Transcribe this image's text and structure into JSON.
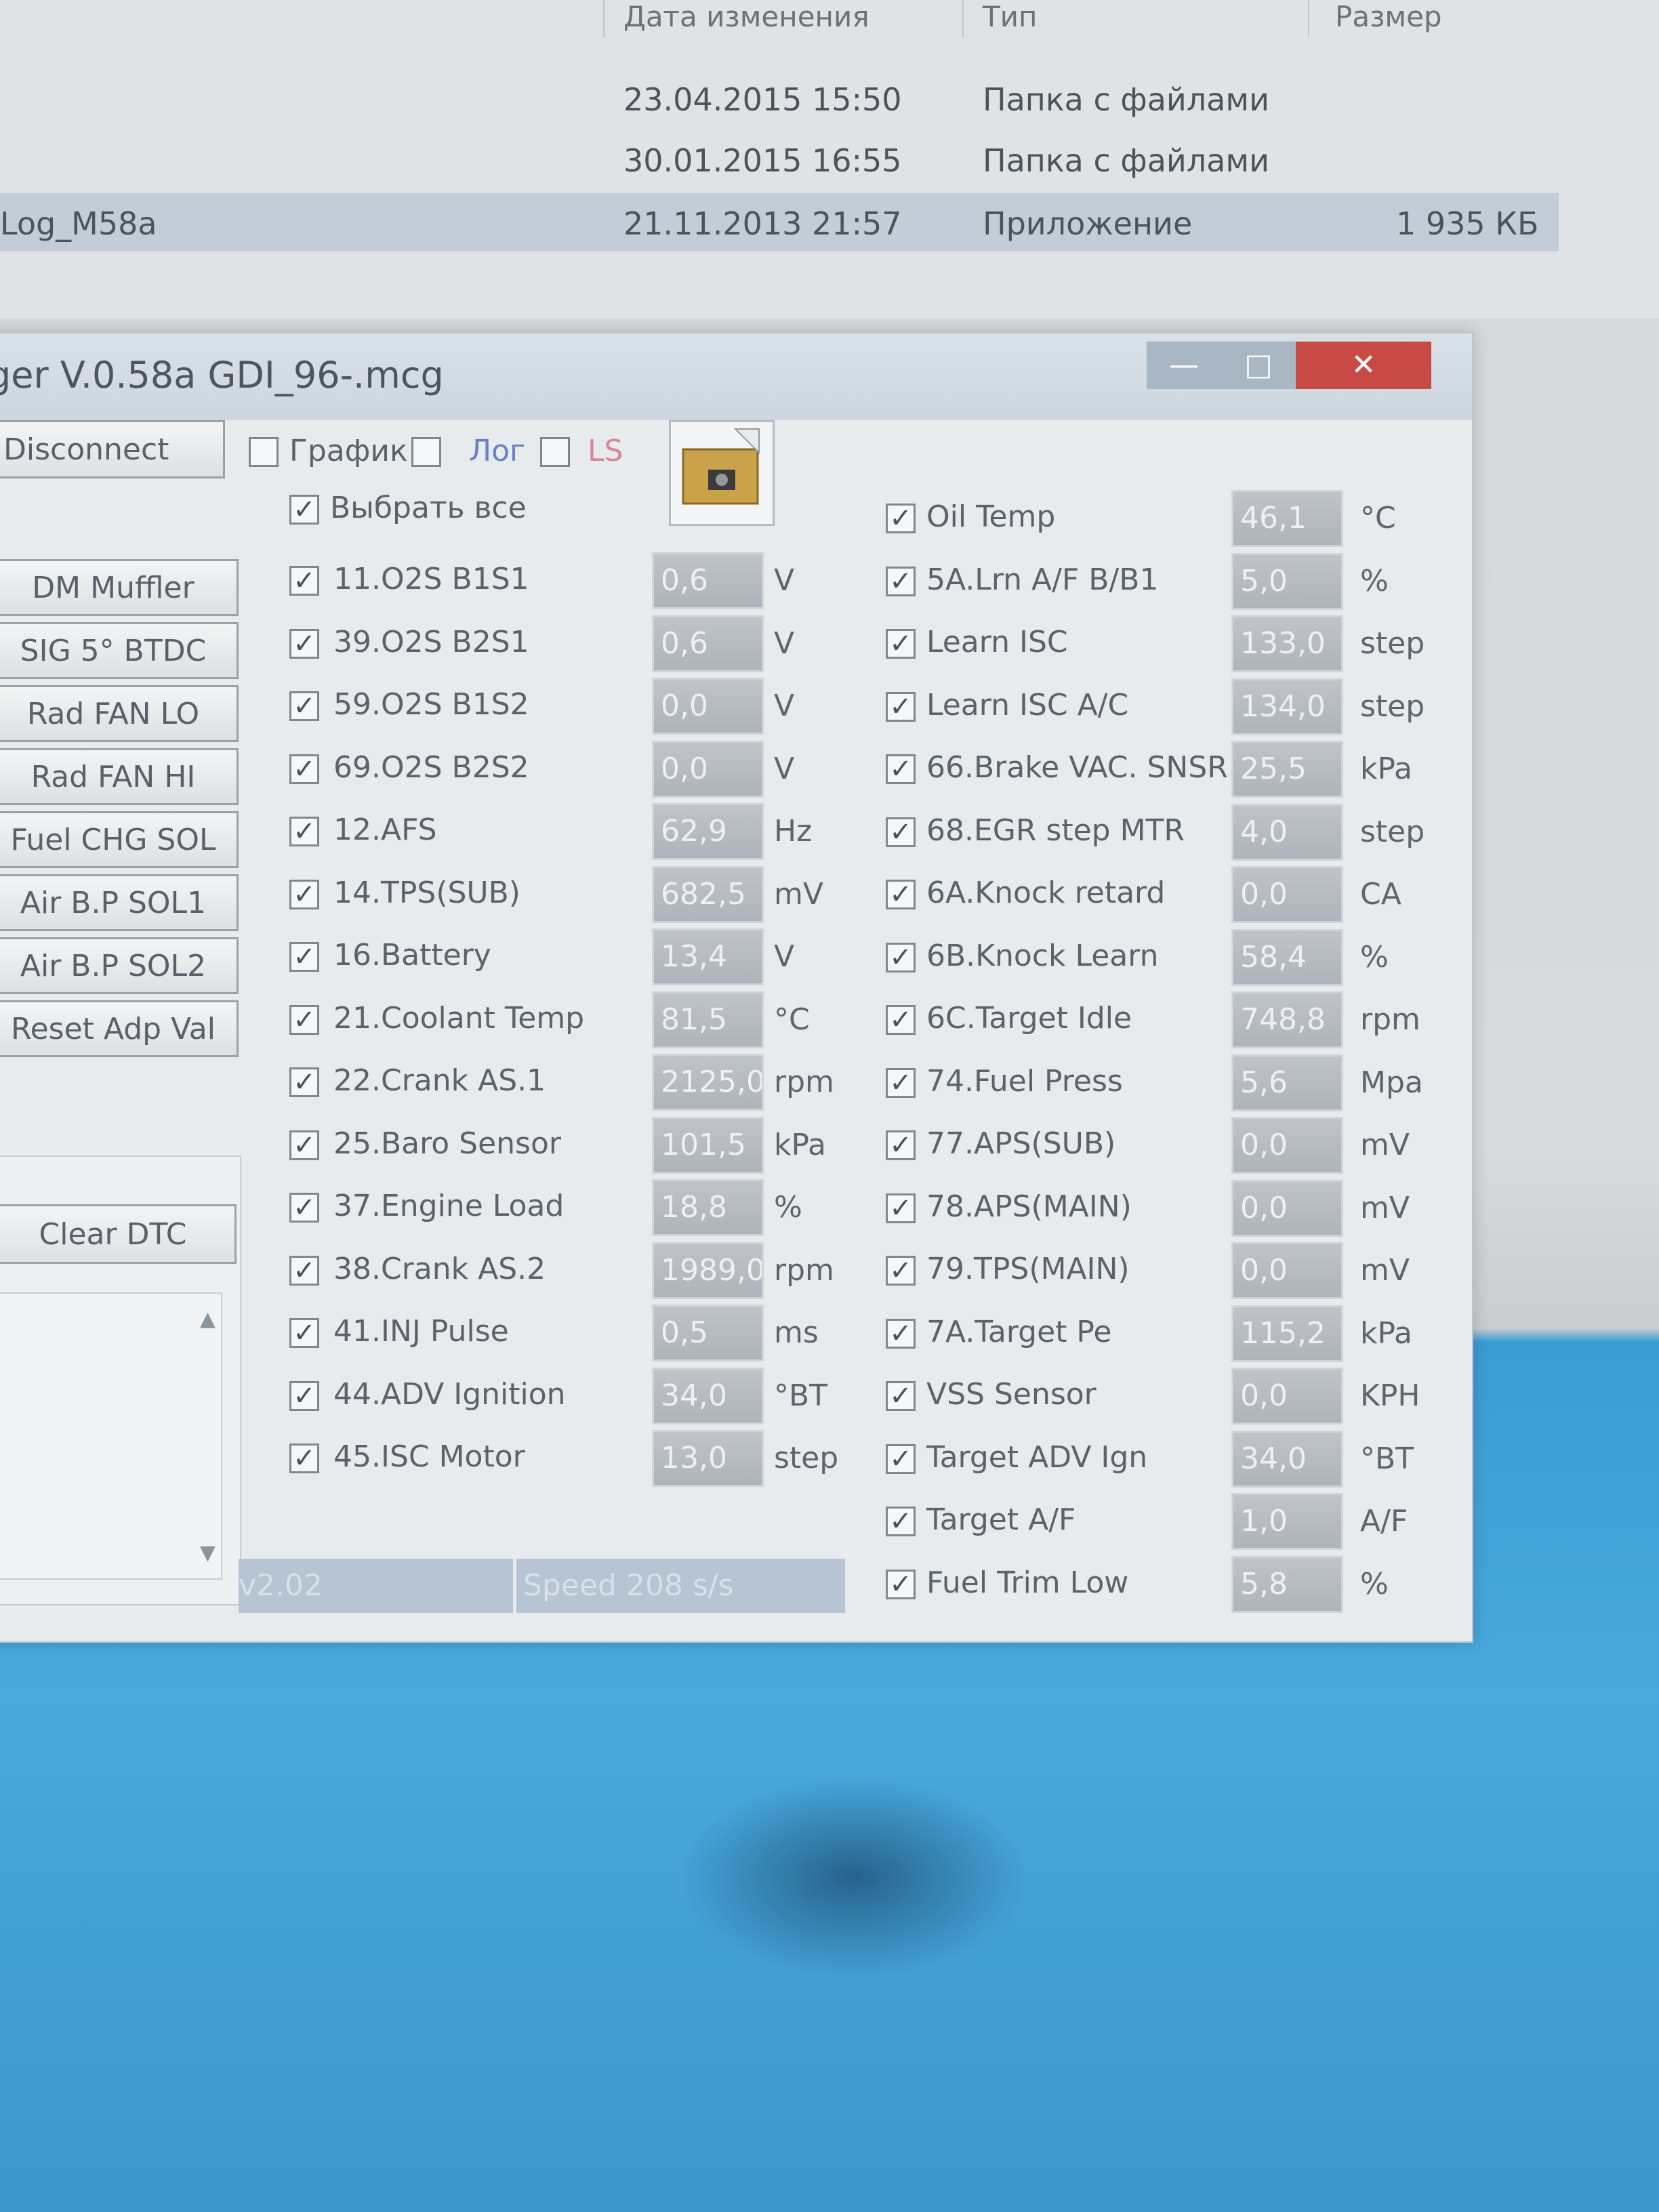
{
  "explorer": {
    "columns": {
      "date": "Дата изменения",
      "type": "Тип",
      "size": "Размер"
    },
    "rows": [
      {
        "name": "",
        "date": "23.04.2015 15:50",
        "type": "Папка с файлами",
        "size": ""
      },
      {
        "name": "",
        "date": "30.01.2015 16:55",
        "type": "Папка с файлами",
        "size": ""
      },
      {
        "name": "Log_M58a",
        "date": "21.11.2013 21:57",
        "type": "Приложение",
        "size": "1 935 КБ"
      }
    ]
  },
  "window": {
    "title": "ger V.0.58a GDI_96-.mcg",
    "controls": {
      "min": "—",
      "max": "□",
      "close": "✕"
    }
  },
  "toolbar": {
    "disconnect": "Disconnect",
    "grafik": "График",
    "log": "Лог",
    "ls": "LS",
    "select_all": "Выбрать все"
  },
  "buttons": [
    "DM Muffler",
    "SIG 5° BTDC",
    "Rad FAN LO",
    "Rad FAN HI",
    "Fuel CHG SOL",
    "Air B.P SOL1",
    "Air B.P SOL2",
    "Reset Adp Val"
  ],
  "clear_dtc": "Clear DTC",
  "status": {
    "left": "v2.02",
    "speed": "Speed 208 s/s"
  },
  "check_mark": "✓",
  "params_left": [
    {
      "label": "11.O2S B1S1",
      "value": "0,6",
      "unit": "V"
    },
    {
      "label": "39.O2S B2S1",
      "value": "0,6",
      "unit": "V"
    },
    {
      "label": "59.O2S B1S2",
      "value": "0,0",
      "unit": "V"
    },
    {
      "label": "69.O2S B2S2",
      "value": "0,0",
      "unit": "V"
    },
    {
      "label": "12.AFS",
      "value": "62,9",
      "unit": "Hz"
    },
    {
      "label": "14.TPS(SUB)",
      "value": "682,5",
      "unit": "mV"
    },
    {
      "label": "16.Battery",
      "value": "13,4",
      "unit": "V"
    },
    {
      "label": "21.Coolant Temp",
      "value": "81,5",
      "unit": "°C"
    },
    {
      "label": "22.Crank AS.1",
      "value": "2125,0",
      "unit": "rpm"
    },
    {
      "label": "25.Baro Sensor",
      "value": "101,5",
      "unit": "kPa"
    },
    {
      "label": "37.Engine Load",
      "value": "18,8",
      "unit": "%"
    },
    {
      "label": "38.Crank AS.2",
      "value": "1989,0",
      "unit": "rpm"
    },
    {
      "label": "41.INJ Pulse",
      "value": "0,5",
      "unit": "ms"
    },
    {
      "label": "44.ADV Ignition",
      "value": "34,0",
      "unit": "°BT"
    },
    {
      "label": "45.ISC Motor",
      "value": "13,0",
      "unit": "step"
    }
  ],
  "params_right": [
    {
      "label": "Oil Temp",
      "value": "46,1",
      "unit": "°C"
    },
    {
      "label": "5A.Lrn A/F B/B1",
      "value": "5,0",
      "unit": "%"
    },
    {
      "label": "Learn ISC",
      "value": "133,0",
      "unit": "step"
    },
    {
      "label": "Learn ISC A/C",
      "value": "134,0",
      "unit": "step"
    },
    {
      "label": "66.Brake VAC. SNSR",
      "value": "25,5",
      "unit": "kPa"
    },
    {
      "label": "68.EGR step MTR",
      "value": "4,0",
      "unit": "step"
    },
    {
      "label": "6A.Knock retard",
      "value": "0,0",
      "unit": "CA"
    },
    {
      "label": "6B.Knock Learn",
      "value": "58,4",
      "unit": "%"
    },
    {
      "label": "6C.Target Idle",
      "value": "748,8",
      "unit": "rpm"
    },
    {
      "label": "74.Fuel Press",
      "value": "5,6",
      "unit": "Mpa"
    },
    {
      "label": "77.APS(SUB)",
      "value": "0,0",
      "unit": "mV"
    },
    {
      "label": "78.APS(MAIN)",
      "value": "0,0",
      "unit": "mV"
    },
    {
      "label": "79.TPS(MAIN)",
      "value": "0,0",
      "unit": "mV"
    },
    {
      "label": "7A.Target Pe",
      "value": "115,2",
      "unit": "kPa"
    },
    {
      "label": "VSS Sensor",
      "value": "0,0",
      "unit": "KPH"
    },
    {
      "label": "Target ADV Ign",
      "value": "34,0",
      "unit": "°BT"
    },
    {
      "label": "Target A/F",
      "value": "1,0",
      "unit": "A/F"
    },
    {
      "label": "Fuel Trim Low",
      "value": "5,8",
      "unit": "%"
    }
  ]
}
